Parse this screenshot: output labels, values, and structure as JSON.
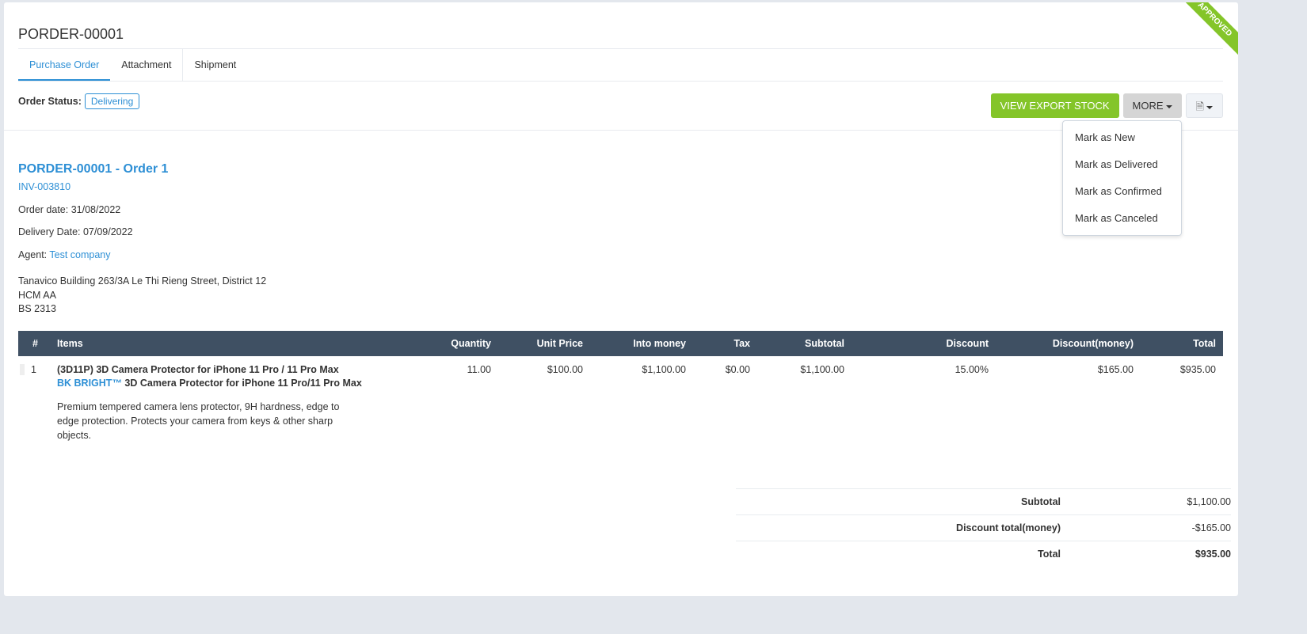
{
  "title": "PORDER-00001",
  "ribbon": "APPROVED",
  "tabs": [
    "Purchase Order",
    "Attachment",
    "Shipment"
  ],
  "status": {
    "label": "Order Status:",
    "value": "Delivering"
  },
  "buttons": {
    "export": "VIEW EXPORT STOCK",
    "more": "MORE"
  },
  "menu": [
    "Mark as New",
    "Mark as Delivered",
    "Mark as Confirmed",
    "Mark as Canceled"
  ],
  "order": {
    "title": "PORDER-00001 - Order 1",
    "invoice": "INV-003810",
    "order_date": "Order date: 31/08/2022",
    "delivery_date": "Delivery Date: 07/09/2022",
    "agent_label": "Agent:",
    "agent": "Test company",
    "address": [
      "Tanavico Building 263/3A Le Thi Rieng Street, District 12",
      "HCM AA",
      "BS 2313"
    ]
  },
  "table": {
    "headers": [
      "#",
      "Items",
      "Quantity",
      "Unit Price",
      "Into money",
      "Tax",
      "Subtotal",
      "Discount",
      "Discount(money)",
      "Total"
    ],
    "rows": [
      {
        "num": "1",
        "name": "(3D11P) 3D Camera Protector for iPhone 11 Pro / 11 Pro Max",
        "brand": "BK BRIGHT™",
        "subname": " 3D Camera Protector for iPhone 11 Pro/11 Pro Max",
        "desc": "Premium tempered camera lens protector, 9H hardness, edge to edge protection. Protects your camera from keys & other sharp objects.",
        "qty": "11.00",
        "price": "$100.00",
        "money": "$1,100.00",
        "tax": "$0.00",
        "subtotal": "$1,100.00",
        "discount": "15.00%",
        "discount_money": "$165.00",
        "total": "$935.00"
      }
    ]
  },
  "totals": [
    {
      "k": "Subtotal",
      "v": "$1,100.00"
    },
    {
      "k": "Discount total(money)",
      "v": "-$165.00"
    },
    {
      "k": "Total",
      "v": "$935.00"
    }
  ]
}
